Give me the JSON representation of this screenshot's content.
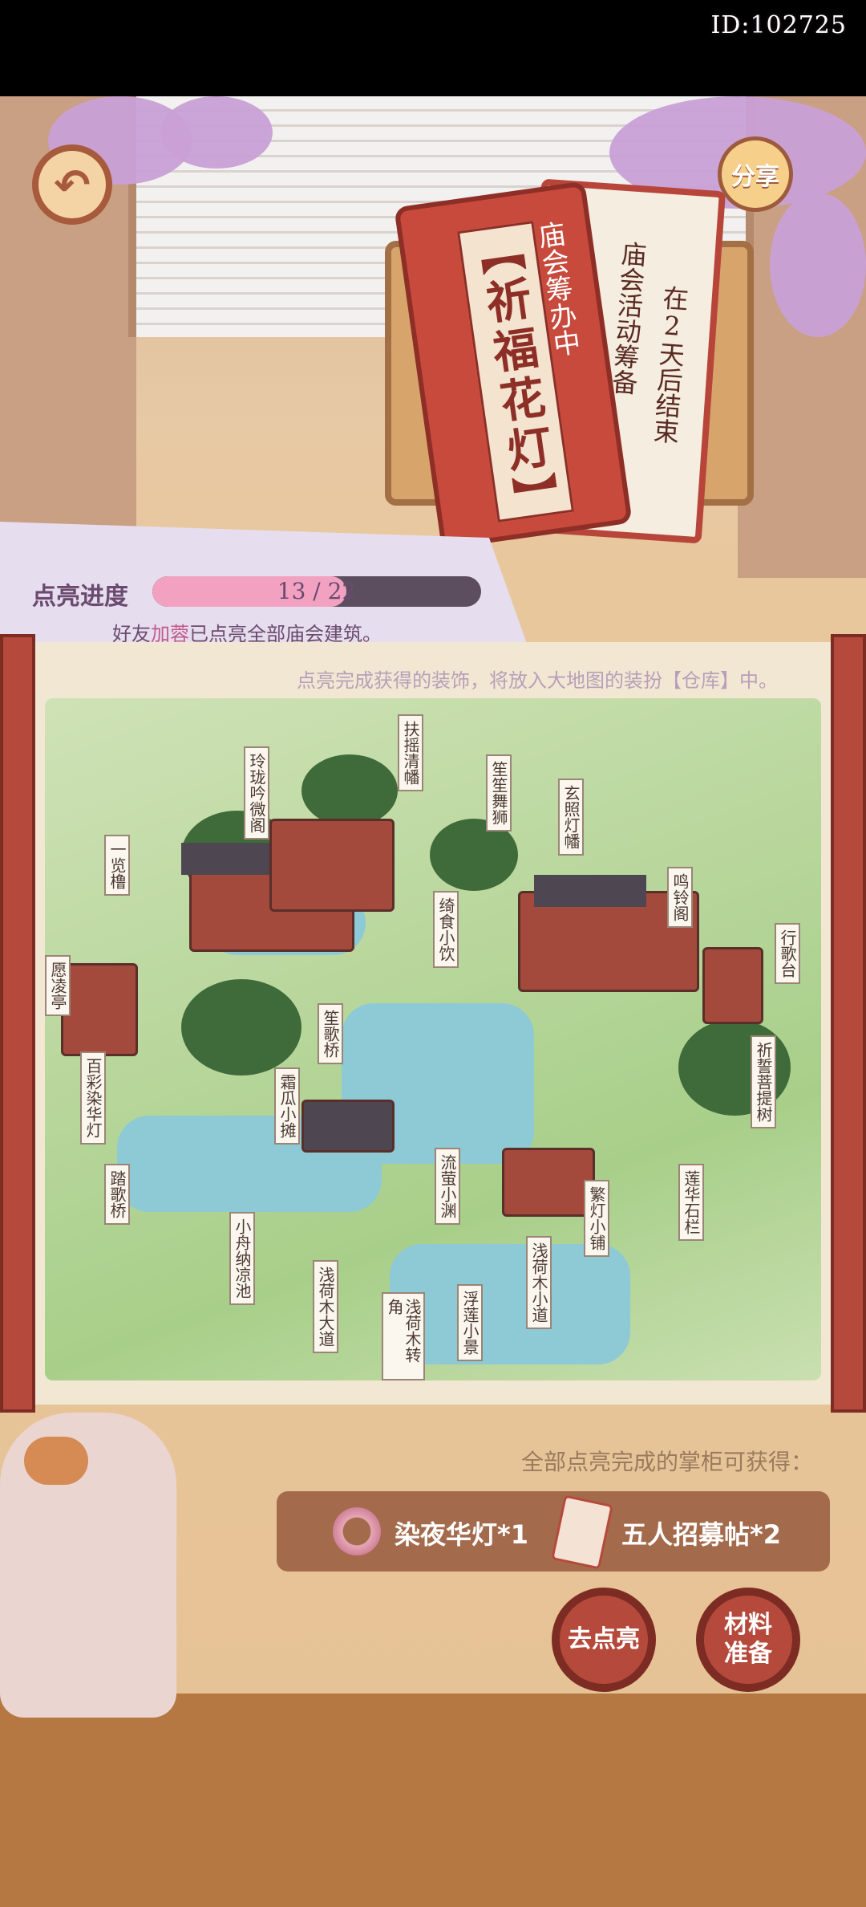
{
  "header": {
    "player_id": "ID:102725"
  },
  "buttons": {
    "share": "分享"
  },
  "event": {
    "title": "【祈福花灯】",
    "status": "庙会筹办中",
    "phase": "庙会活动筹备",
    "remaining": "在2天后结束"
  },
  "progress": {
    "label": "点亮进度",
    "current": 13,
    "total": 22,
    "text": "13 / 22",
    "friend_notice_prefix": "好友",
    "friend_name": "加蓉",
    "friend_notice_suffix": "已点亮全部庙会建筑。"
  },
  "map": {
    "hint": "点亮完成获得的装饰，将放入大地图的装扮【仓库】中。",
    "buildings": [
      "扶摇清幡",
      "玲珑吟微阁",
      "笙笙舞狮",
      "玄照灯幡",
      "一览橹",
      "鸣铃阁",
      "绮食小饮",
      "行歌台",
      "愿凌亭",
      "笙歌桥",
      "祈誓菩提树",
      "百彩染华灯",
      "霜瓜小摊",
      "踏歌桥",
      "流萤小渊",
      "繁灯小铺",
      "莲华石栏",
      "小舟纳凉池",
      "浅荷木大道",
      "浅荷木转角",
      "浮莲小景",
      "浅荷木小道"
    ]
  },
  "rewards": {
    "title": "全部点亮完成的掌柜可获得：",
    "items": [
      {
        "label": "染夜华灯*1",
        "icon": "lantern-wreath-icon"
      },
      {
        "label": "五人招募帖*2",
        "icon": "recruit-card-icon"
      }
    ]
  },
  "actions": {
    "light_up": "去点亮",
    "materials": "材料准备"
  }
}
